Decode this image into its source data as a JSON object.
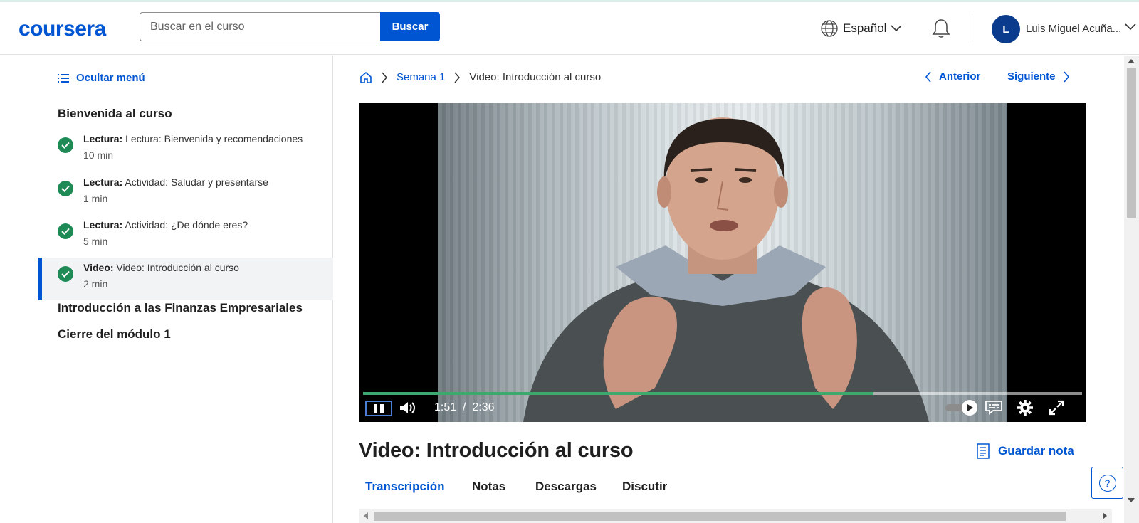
{
  "header": {
    "logo": "coursera",
    "search_placeholder": "Buscar en el curso",
    "search_button": "Buscar",
    "language": "Español",
    "user_initial": "L",
    "user_name": "Luis Miguel Acuña..."
  },
  "sidebar": {
    "hide_menu": "Ocultar menú",
    "sections": [
      {
        "title": "Bienvenida al curso"
      },
      {
        "title": "Introducción a las Finanzas Empresariales"
      },
      {
        "title": "Cierre del módulo 1"
      }
    ],
    "items": [
      {
        "type": "Lectura:",
        "name": "Lectura: Bienvenida y recomendaciones",
        "duration": "10 min",
        "completed": true
      },
      {
        "type": "Lectura:",
        "name": "Actividad: Saludar y presentarse",
        "duration": "1 min",
        "completed": true
      },
      {
        "type": "Lectura:",
        "name": "Actividad: ¿De dónde eres?",
        "duration": "5 min",
        "completed": true
      },
      {
        "type": "Video:",
        "name": "Video: Introducción al curso",
        "duration": "2 min",
        "completed": true,
        "active": true
      }
    ]
  },
  "breadcrumb": {
    "week": "Semana 1",
    "current": "Video: Introducción al curso"
  },
  "nav": {
    "previous": "Anterior",
    "next": "Siguiente"
  },
  "player": {
    "current_time": "1:51",
    "separator": "/",
    "duration": "2:36",
    "progress": 0.71
  },
  "content": {
    "title": "Video: Introducción al curso",
    "save_note": "Guardar nota",
    "tabs": [
      "Transcripción",
      "Notas",
      "Descargas",
      "Discutir"
    ],
    "help": "?"
  },
  "colors": {
    "brand": "#0056d2",
    "check": "#1e8a55",
    "progress": "#3fa86e"
  }
}
